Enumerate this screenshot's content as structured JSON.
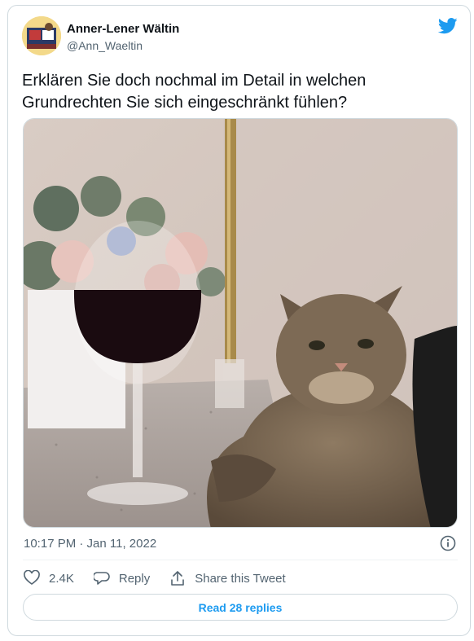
{
  "author": {
    "name": "Anner-Lener Wältin",
    "handle": "@Ann_Waeltin"
  },
  "tweet": {
    "text": "Erklären Sie doch nochmal im Detail in welchen Grundrechten Sie sich eingeschränkt fühlen?"
  },
  "meta": {
    "timestamp": "10:17 PM · Jan 11, 2022"
  },
  "actions": {
    "likes": "2.4K",
    "reply_label": "Reply",
    "share_label": "Share this Tweet"
  },
  "read_replies": "Read 28 replies",
  "colors": {
    "accent": "#1d9bf0",
    "muted": "#536471",
    "border": "#cfd9de"
  }
}
